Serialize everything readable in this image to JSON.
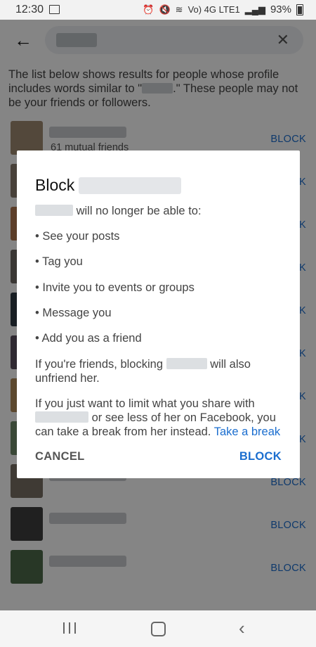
{
  "status_bar": {
    "time": "12:30",
    "network_label": "Vo) 4G LTE1",
    "battery": "93%"
  },
  "search": {
    "clear_icon": "close-icon"
  },
  "intro": {
    "part1": "The list below shows results for people whose profile includes words similar to \"",
    "part2": ".\" These people may not be your friends or followers."
  },
  "results": {
    "first_mutual": "61 mutual friends",
    "block_label": "BLOCK"
  },
  "dialog": {
    "title_prefix": "Block",
    "lead": "will no longer be able to:",
    "bullets": [
      "• See your posts",
      "• Tag you",
      "• Invite you to events or groups",
      "• Message you",
      "• Add you as a friend"
    ],
    "unfriend_part1": "If you're friends, blocking",
    "unfriend_part2": "will also unfriend her.",
    "limit_part1": "If you just want to limit what you share with",
    "limit_part2": "or see less of her on Facebook, you can take a break from her instead.",
    "take_break_link": "Take a break",
    "cancel_label": "CANCEL",
    "block_label": "BLOCK"
  },
  "colors": {
    "accent": "#1b6ecf",
    "scrim": "#000000"
  }
}
